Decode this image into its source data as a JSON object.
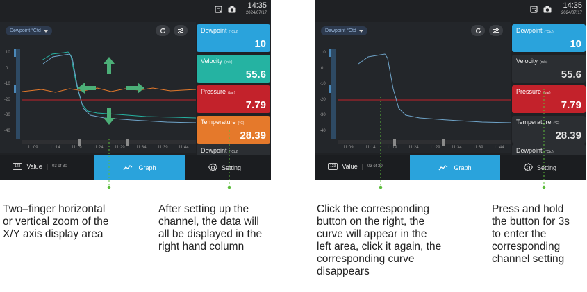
{
  "status": {
    "time": "14:35",
    "date": "2024/07/17",
    "icons": [
      "device-sync-icon",
      "camera-icon"
    ]
  },
  "graph": {
    "channel_select": "Dewpoint °Ctd",
    "refresh_icon": "refresh-icon",
    "settings_icon": "sliders-icon",
    "y_ticks": [
      "10",
      "0",
      "-10",
      "-20",
      "-30",
      "-40"
    ],
    "x_ticks": [
      "11:09",
      "11:14",
      "11:19",
      "11:24",
      "11:29",
      "11:34",
      "11:39",
      "11:44"
    ]
  },
  "left_cards": [
    {
      "name": "Dewpoint",
      "unit": "(°Ctd)",
      "value": "10",
      "color": "#2aa3dc"
    },
    {
      "name": "Velocity",
      "unit": "(m/s)",
      "value": "55.6",
      "color": "#25b3a2"
    },
    {
      "name": "Pressure",
      "unit": "(bar)",
      "value": "7.79",
      "color": "#c3222b"
    },
    {
      "name": "Temperature",
      "unit": "(°C)",
      "value": "28.39",
      "color": "#e5792b"
    },
    {
      "name": "Dewpoint",
      "unit": "(°Ctd)",
      "value": "",
      "color": "#2b2e32"
    }
  ],
  "right_cards": [
    {
      "name": "Dewpoint",
      "unit": "(°Ctd)",
      "value": "10",
      "color": "#2aa3dc"
    },
    {
      "name": "Velocity",
      "unit": "(m/s)",
      "value": "55.6",
      "color": "#2b2e32"
    },
    {
      "name": "Pressure",
      "unit": "(bar)",
      "value": "7.79",
      "color": "#c3222b"
    },
    {
      "name": "Temperature",
      "unit": "(°C)",
      "value": "28.39",
      "color": "#2b2e32"
    },
    {
      "name": "Dewpoint",
      "unit": "(°Ctd)",
      "value": "",
      "color": "#2b2e32"
    }
  ],
  "tabs": {
    "value_label": "Value",
    "left_value_count": "03 of 30",
    "right_value_count": "03 of 30",
    "graph_label": "Graph",
    "setting_label": "Setting",
    "value_icon_text": "123"
  },
  "callouts": {
    "zoom": [
      "Two–finger horizontal",
      "or vertical zoom of the",
      "X/Y axis display area"
    ],
    "column": [
      "After setting up the",
      "channel, the data will",
      "all be displayed in the",
      "right hand column"
    ],
    "toggle": [
      "Click the corresponding",
      "button on the right, the",
      "curve will appear in the",
      "left area, click it again, the",
      "corresponding curve",
      "disappears"
    ],
    "hold": [
      "Press and hold",
      "the button for 3s",
      "to enter the",
      "corresponding",
      "channel setting"
    ]
  },
  "colors": {
    "accent": "#2aa3dc",
    "arrow_green": "#4caf78",
    "leader_green": "#5cbd3c"
  }
}
